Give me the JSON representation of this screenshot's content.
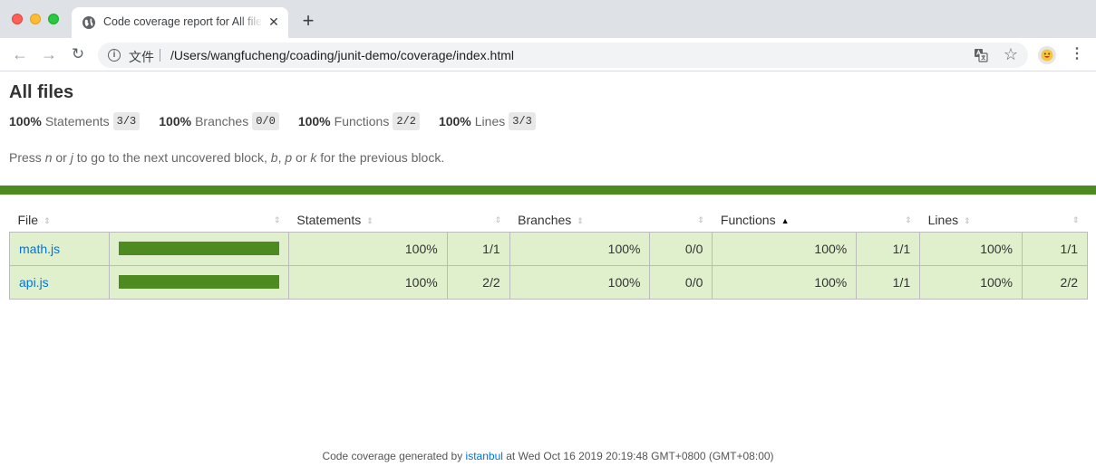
{
  "browser": {
    "tab_title": "Code coverage report for All files",
    "tab_close": "✕",
    "new_tab": "+",
    "back": "←",
    "forward": "→",
    "reload": "↻",
    "scheme_label": "文件",
    "url": "/Users/wangfucheng/coading/junit-demo/coverage/index.html",
    "star": "☆",
    "menu": "⋮"
  },
  "page": {
    "title": "All files",
    "summary": [
      {
        "pct": "100%",
        "label": "Statements",
        "fraction": "3/3"
      },
      {
        "pct": "100%",
        "label": "Branches",
        "fraction": "0/0"
      },
      {
        "pct": "100%",
        "label": "Functions",
        "fraction": "2/2"
      },
      {
        "pct": "100%",
        "label": "Lines",
        "fraction": "3/3"
      }
    ],
    "hint": {
      "p1": "Press ",
      "k1": "n",
      "p2": " or ",
      "k2": "j",
      "p3": " to go to the next uncovered block, ",
      "k3": "b",
      "p4": ", ",
      "k4": "p",
      "p5": " or ",
      "k5": "k",
      "p6": " for the previous block."
    },
    "status_color": "#4d8a1f"
  },
  "table": {
    "headers": {
      "file": "File",
      "statements": "Statements",
      "branches": "Branches",
      "functions": "Functions",
      "lines": "Lines"
    },
    "sort_icon": "⇕",
    "sort_active_icon": "▲",
    "rows": [
      {
        "file": "math.js",
        "coverage_fraction": 1.0,
        "statements_pct": "100%",
        "statements": "1/1",
        "branches_pct": "100%",
        "branches": "0/0",
        "functions_pct": "100%",
        "functions": "1/1",
        "lines_pct": "100%",
        "lines": "1/1"
      },
      {
        "file": "api.js",
        "coverage_fraction": 1.0,
        "statements_pct": "100%",
        "statements": "2/2",
        "branches_pct": "100%",
        "branches": "0/0",
        "functions_pct": "100%",
        "functions": "1/1",
        "lines_pct": "100%",
        "lines": "2/2"
      }
    ]
  },
  "footer": {
    "prefix": "Code coverage generated by ",
    "tool": "istanbul",
    "suffix": " at Wed Oct 16 2019 20:19:48 GMT+0800 (GMT+08:00)"
  }
}
